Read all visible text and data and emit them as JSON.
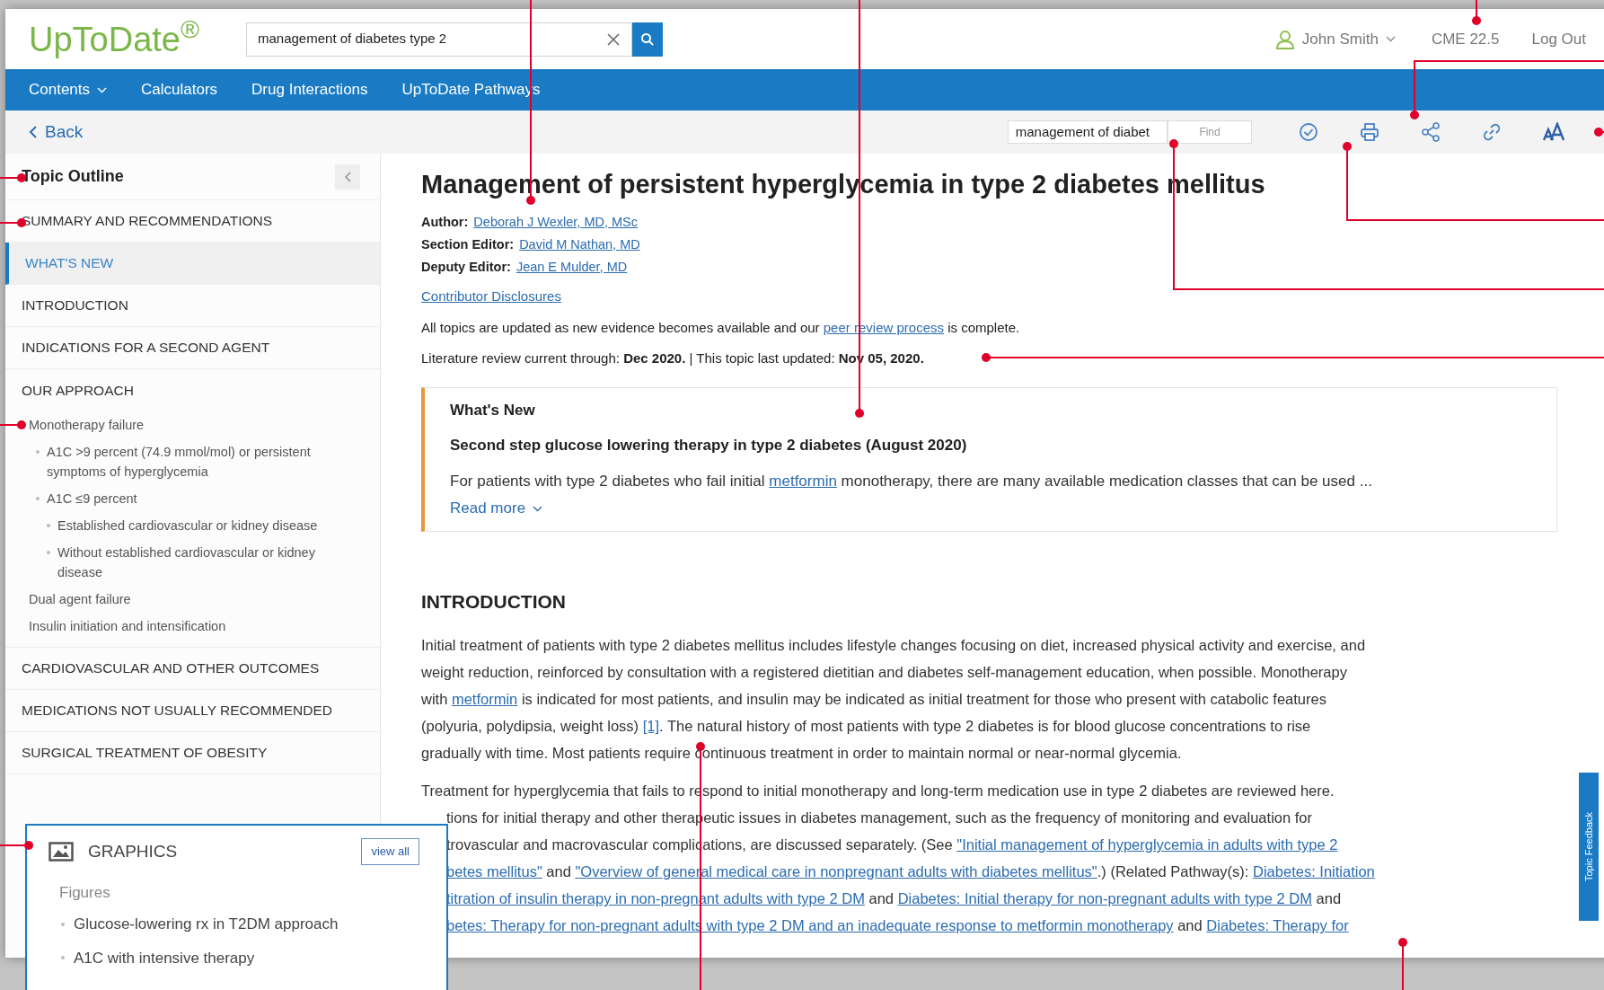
{
  "header": {
    "logo": "UpToDate$^{®}$",
    "search": {
      "value": "management of diabetes type 2"
    },
    "user": "John Smith",
    "cme": "CME 22.5",
    "logout": "Log Out"
  },
  "nav": [
    {
      "label": "Contents",
      "dropdown": true
    },
    {
      "label": "Calculators",
      "dropdown": false
    },
    {
      "label": "Drug Interactions",
      "dropdown": false
    },
    {
      "label": "UpToDate Pathways",
      "dropdown": false
    }
  ],
  "toolbar": {
    "back": "Back",
    "find": {
      "value": "management of diabet",
      "button": "Find"
    }
  },
  "outline": {
    "title": "Topic Outline",
    "items": [
      {
        "label": "SUMMARY AND RECOMMENDATIONS",
        "selected": false
      },
      {
        "label": "WHAT'S NEW",
        "selected": true
      },
      {
        "label": "INTRODUCTION",
        "selected": false
      },
      {
        "label": "INDICATIONS FOR A SECOND AGENT",
        "selected": false
      },
      {
        "label": "OUR APPROACH",
        "selected": false,
        "children": [
          {
            "label": "Monotherapy failure",
            "selected": false,
            "children": [
              {
                "label": "A1C >9 percent (74.9 mmol/mol) or persistent symptoms of hyperglycemia",
                "selected": false
              },
              {
                "label": "A1C ≤9 percent",
                "selected": false,
                "children": [
                  {
                    "label": "Established cardiovascular or kidney disease",
                    "selected": false
                  },
                  {
                    "label": "Without established cardiovascular or kidney disease",
                    "selected": false
                  }
                ]
              }
            ]
          },
          {
            "label": "Dual agent failure",
            "selected": false
          },
          {
            "label": "Insulin initiation and intensification",
            "selected": false
          }
        ]
      },
      {
        "label": "CARDIOVASCULAR AND OTHER OUTCOMES",
        "selected": false
      },
      {
        "label": "MEDICATIONS NOT USUALLY RECOMMENDED",
        "selected": false
      },
      {
        "label": "SURGICAL TREATMENT OF OBESITY",
        "selected": false
      }
    ]
  },
  "graphics": {
    "title": "GRAPHICS",
    "view_all": "view all",
    "group": "Figures",
    "items": [
      "Glucose-lowering rx in T2DM approach",
      "A1C with intensive therapy"
    ]
  },
  "article": {
    "title": "Management of persistent hyperglycemia in type 2 diabetes mellitus",
    "credits": [
      {
        "role": "Author:",
        "name": "Deborah J Wexler, MD, MSc"
      },
      {
        "role": "Section Editor:",
        "name": "David M Nathan, MD"
      },
      {
        "role": "Deputy Editor:",
        "name": "Jean E Mulder, MD"
      }
    ],
    "disclosures": "Contributor Disclosures",
    "update_note": [
      {
        "text": "All topics are updated as new evidence becomes available and our ",
        "link": false
      },
      {
        "text": "peer review process",
        "link": true
      },
      {
        "text": " is complete.",
        "link": false
      }
    ],
    "review_line": "Literature review current through: **Dec 2020.** | This topic last updated: **Nov 05, 2020.**"
  },
  "whats_new": {
    "heading": "What's New",
    "subtitle": "Second step glucose lowering therapy in type 2 diabetes (August 2020)",
    "text": [
      {
        "text": "For patients with type 2 diabetes who fail initial ",
        "link": false
      },
      {
        "text": "metformin",
        "link": true
      },
      {
        "text": " monotherapy, there are many available medication classes that can be used ...",
        "link": false
      }
    ],
    "read_more": "Read more"
  },
  "introduction": {
    "heading": "INTRODUCTION",
    "paragraph_lines": [
      [
        {
          "text": "Initial treatment of patients with type 2 diabetes mellitus includes lifestyle changes focusing on diet, increased physical activity and exercise, and",
          "link": false
        }
      ],
      [
        {
          "text": "weight reduction, reinforced by consultation with a registered dietitian and diabetes self-management education, when possible. Monotherapy",
          "link": false
        }
      ],
      [
        {
          "text": "with ",
          "link": false
        },
        {
          "text": "metformin",
          "link": true
        },
        {
          "text": " is indicated for most patients, and insulin may be indicated as initial treatment for those who present with catabolic features",
          "link": false
        }
      ],
      [
        {
          "text": "(polyuria, polydipsia, weight loss) ",
          "link": false
        },
        {
          "text": "[1]",
          "link": true
        },
        {
          "text": ". The natural history of most patients with type 2 diabetes is for blood glucose concentrations to rise",
          "link": false
        }
      ],
      [
        {
          "text": "gradually with time. Most patients require continuous treatment in order to maintain normal or near-normal glycemia.",
          "link": false
        }
      ]
    ],
    "paragraph_2_lines": [
      {
        "clipped": false,
        "segments": [
          {
            "text": "Treatment for hyperglycemia that fails to respond to initial monotherapy and long-term medication use in type 2 diabetes are reviewed here.",
            "link": false
          }
        ]
      },
      {
        "clipped": true,
        "segments": [
          {
            "text": "tions for initial therapy and other therapeutic issues in diabetes management, such as the frequency of monitoring and evaluation for",
            "link": false
          }
        ]
      },
      {
        "clipped": true,
        "segments": [
          {
            "text": "trovascular and macrovascular complications, are discussed separately. (See ",
            "link": false
          },
          {
            "text": "\"Initial management of hyperglycemia in adults with type 2",
            "link": true
          }
        ]
      },
      {
        "clipped": true,
        "segments": [
          {
            "text": "betes mellitus\"",
            "link": true
          },
          {
            "text": " and ",
            "link": false
          },
          {
            "text": "\"Overview of general medical care in nonpregnant adults with diabetes mellitus\"",
            "link": true
          },
          {
            "text": ".) (Related Pathway(s): ",
            "link": false
          },
          {
            "text": "Diabetes: Initiation",
            "link": true
          }
        ]
      },
      {
        "clipped": true,
        "segments": [
          {
            "text": "titration of insulin therapy in non-pregnant adults with type 2 DM",
            "link": true
          },
          {
            "text": " and ",
            "link": false
          },
          {
            "text": "Diabetes: Initial therapy for non-pregnant adults with type 2 DM",
            "link": true
          },
          {
            "text": " and",
            "link": false
          }
        ]
      },
      {
        "clipped": true,
        "segments": [
          {
            "text": "betes: Therapy for non-pregnant adults with type 2 DM and an inadequate response to metformin monotherapy",
            "link": true
          },
          {
            "text": " and ",
            "link": false
          },
          {
            "text": "Diabetes: Therapy for",
            "link": true
          }
        ]
      }
    ]
  },
  "feedback_tab": "Topic Feedback"
}
